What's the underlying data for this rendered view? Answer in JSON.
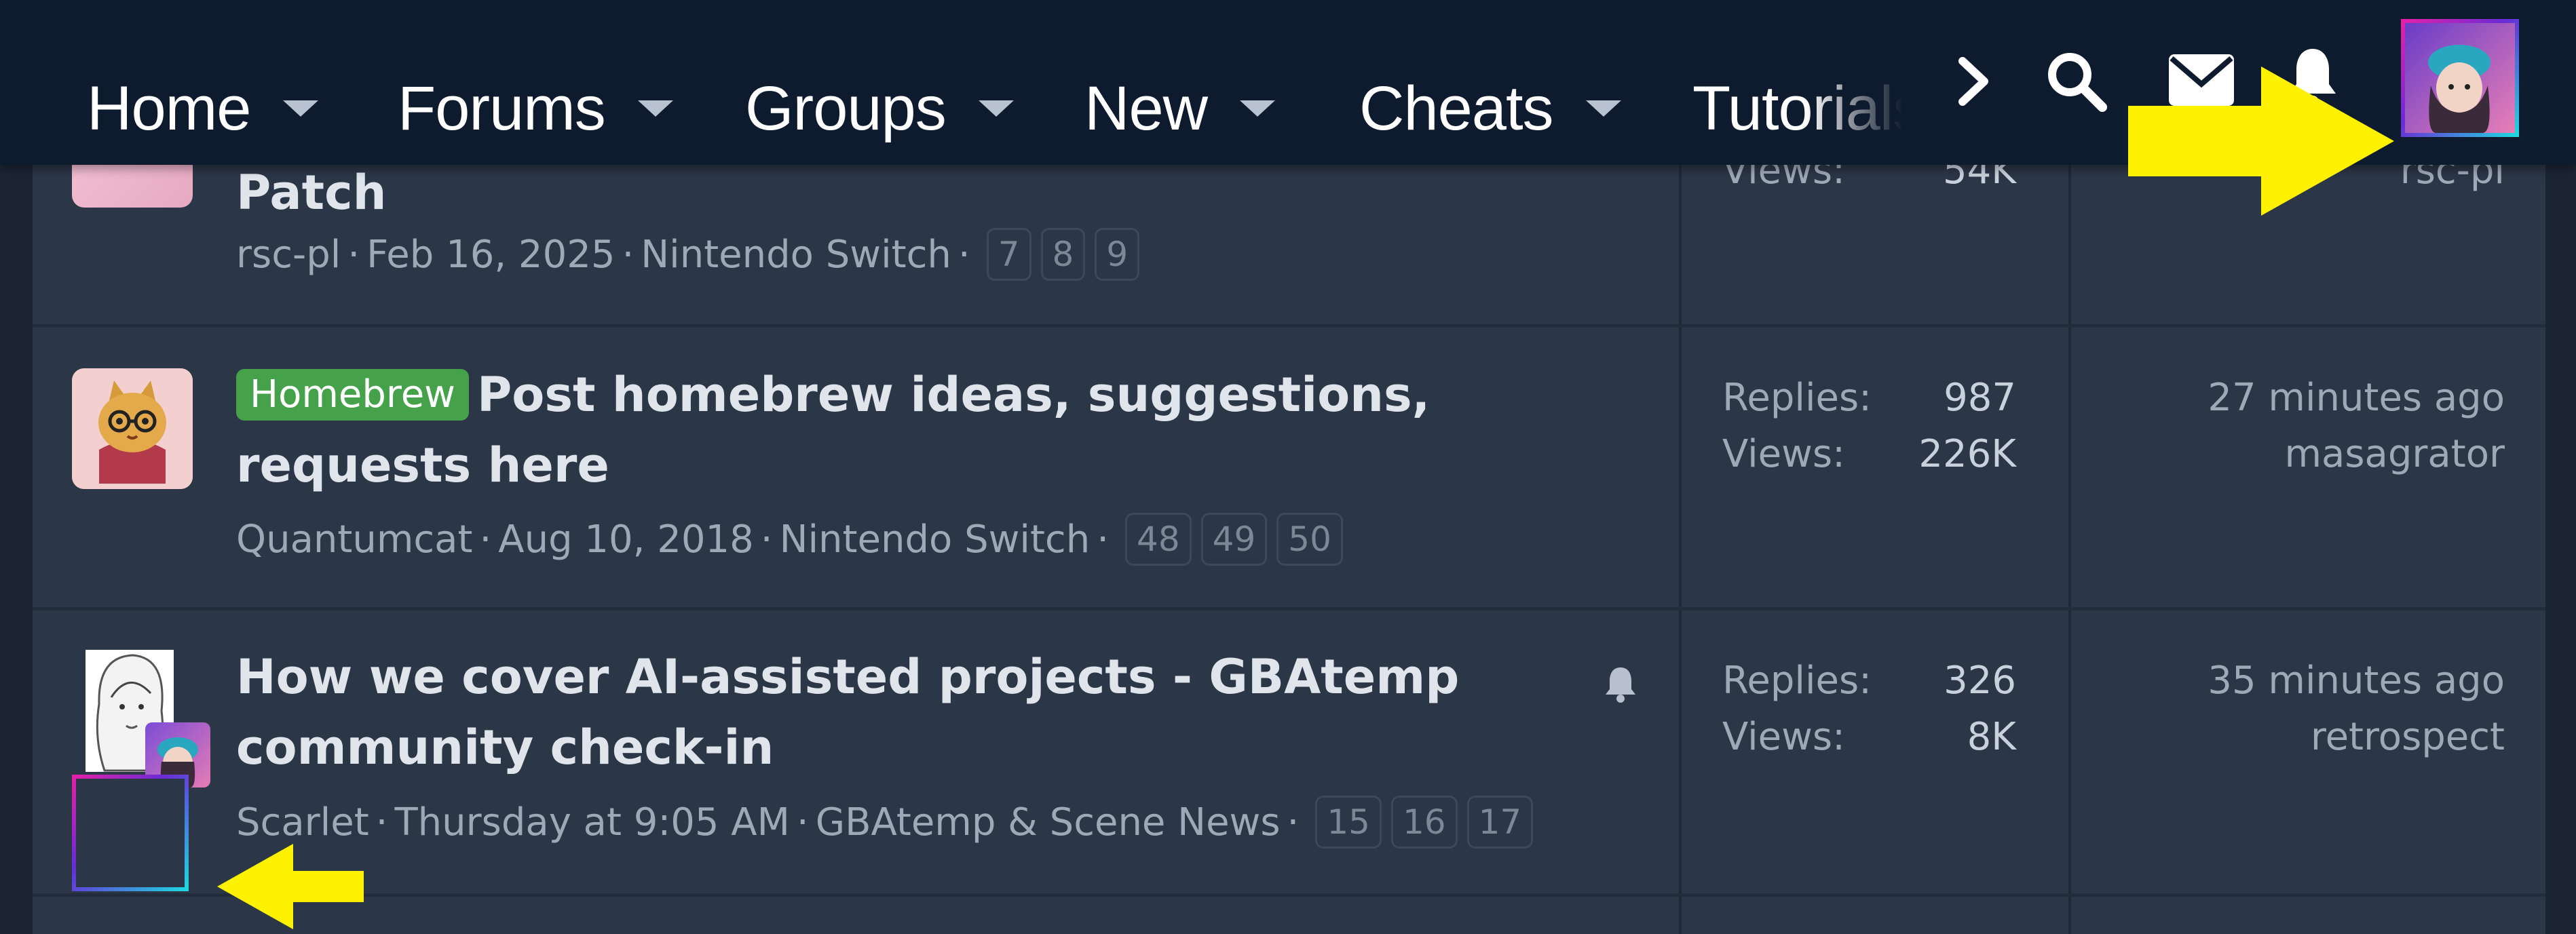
{
  "nav": {
    "items": [
      {
        "label": "Home"
      },
      {
        "label": "Forums"
      },
      {
        "label": "Groups"
      },
      {
        "label": "New"
      },
      {
        "label": "Cheats"
      },
      {
        "label": "Tutorials"
      }
    ],
    "icons": [
      "chevron-right-icon",
      "search-icon",
      "envelope-icon",
      "bell-icon",
      "user-avatar"
    ]
  },
  "threads": [
    {
      "title": "Patch",
      "author": "rsc-pl",
      "date": "Feb 16, 2025",
      "forum": "Nintendo Switch",
      "pages": [
        "7",
        "8",
        "9"
      ],
      "views_label": "Views:",
      "views": "54K",
      "last_user": "rsc-pl"
    },
    {
      "prefix": "Homebrew",
      "title": "Post homebrew ideas, suggestions, requests here",
      "author": "Quantumcat",
      "date": "Aug 10, 2018",
      "forum": "Nintendo Switch",
      "pages": [
        "48",
        "49",
        "50"
      ],
      "replies_label": "Replies:",
      "replies": "987",
      "views_label": "Views:",
      "views": "226K",
      "last_time": "27 minutes ago",
      "last_user": "masagrator"
    },
    {
      "title": "How we cover AI-assisted projects - GBAtemp community check-in",
      "author": "Scarlet",
      "date": "Thursday at 9:05 AM",
      "forum": "GBAtemp & Scene News",
      "pages": [
        "15",
        "16",
        "17"
      ],
      "replies_label": "Replies:",
      "replies": "326",
      "views_label": "Views:",
      "views": "8K",
      "last_time": "35 minutes ago",
      "last_user": "retrospect"
    }
  ],
  "colors": {
    "nav_bg": "#0e1a2d",
    "list_bg": "#2b3647",
    "prefix_green": "#46a24a",
    "annotation_arrow": "#fff200"
  }
}
